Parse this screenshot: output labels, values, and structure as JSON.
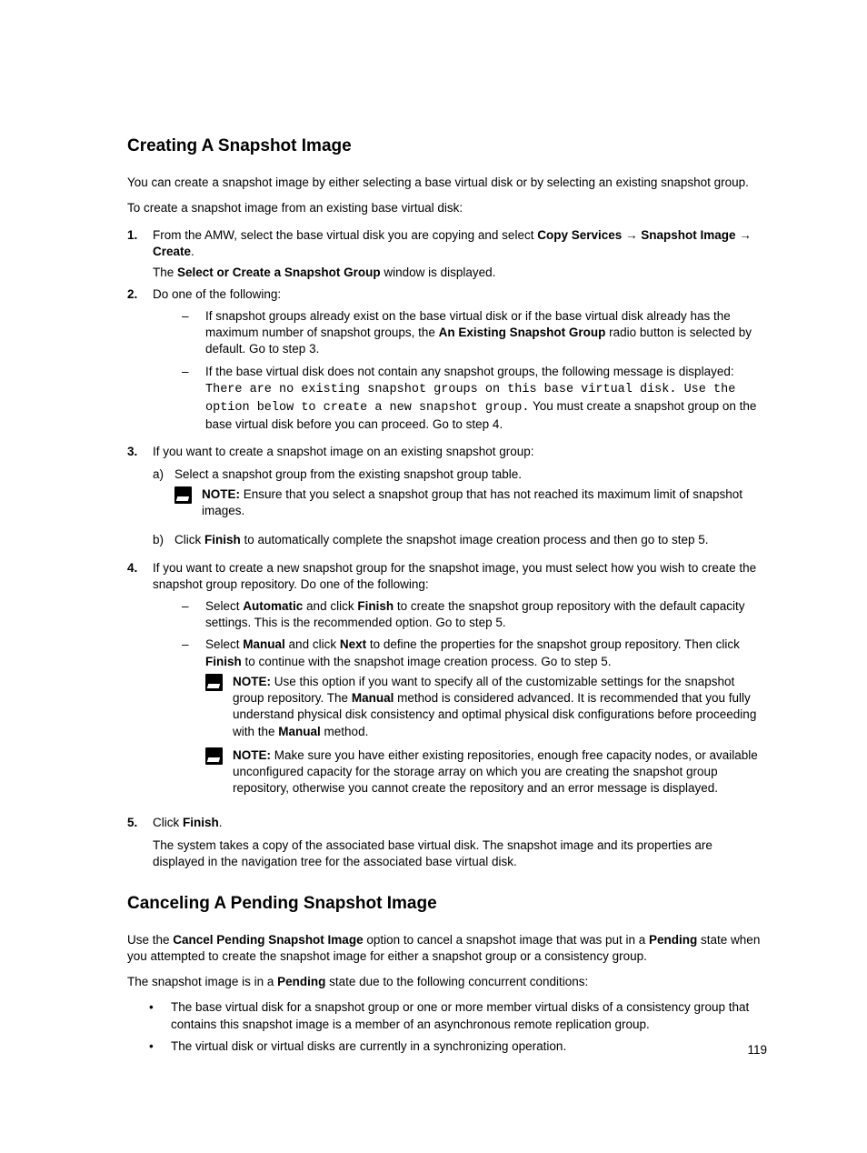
{
  "section1": {
    "heading": "Creating A Snapshot Image",
    "intro1": "You can create a snapshot image by either selecting a base virtual disk or by selecting an existing snapshot group.",
    "intro2": "To create a snapshot image from an existing base virtual disk:",
    "step1_a": "From the AMW, select the base virtual disk you are copying and select ",
    "step1_b_bold": "Copy Services → Snapshot Image → Create",
    "step1_c": ".",
    "step1_line2_a": "The ",
    "step1_line2_b": "Select or Create a Snapshot Group",
    "step1_line2_c": " window is displayed.",
    "step2": "Do one of the following:",
    "step2_d1_a": "If snapshot groups already exist on the base virtual disk or if the base virtual disk already has the maximum number of snapshot groups, the ",
    "step2_d1_b": "An Existing Snapshot Group",
    "step2_d1_c": " radio button is selected by default. Go to step 3.",
    "step2_d2_a": "If the base virtual disk does not contain any snapshot groups, the following message is displayed: ",
    "step2_d2_mono": "There are no existing snapshot groups on this base virtual disk. Use the option below to create a new snapshot group.",
    "step2_d2_b": " You must create a snapshot group on the base virtual disk before you can proceed. Go to step 4.",
    "step3": "If you want to create a snapshot image on an existing snapshot group:",
    "step3_a": "Select a snapshot group from the existing snapshot group table.",
    "note1_label": "NOTE: ",
    "note1_text": "Ensure that you select a snapshot group that has not reached its maximum limit of snapshot images.",
    "step3_b_a": "Click ",
    "step3_b_bold": "Finish",
    "step3_b_c": " to automatically complete the snapshot image creation process and then go to step 5.",
    "step4": "If you want to create a new snapshot group for the snapshot image, you must select how you wish to create the snapshot group repository. Do one of the following:",
    "step4_d1_a": "Select ",
    "step4_d1_b": "Automatic",
    "step4_d1_c": " and click ",
    "step4_d1_d": "Finish",
    "step4_d1_e": " to create the snapshot group repository with the default capacity settings. This is the recommended option. Go to step 5.",
    "step4_d2_a": "Select ",
    "step4_d2_b": "Manual",
    "step4_d2_c": " and click ",
    "step4_d2_d": "Next",
    "step4_d2_e": " to define the properties for the snapshot group repository. Then click ",
    "step4_d2_f": "Finish",
    "step4_d2_g": " to continue with the snapshot image creation process. Go to step 5.",
    "note2_label": "NOTE: ",
    "note2_a": "Use this option if you want to specify all of the customizable settings for the snapshot group repository. The ",
    "note2_b": "Manual",
    "note2_c": " method is considered advanced. It is recommended that you fully understand physical disk consistency and optimal physical disk configurations before proceeding with the ",
    "note2_d": "Manual",
    "note2_e": " method.",
    "note3_label": "NOTE: ",
    "note3_text": "Make sure you have either existing repositories, enough free capacity nodes, or available unconfigured capacity for the storage array on which you are creating the snapshot group repository, otherwise you cannot create the repository and an error message is displayed.",
    "step5_a": "Click ",
    "step5_b": "Finish",
    "step5_c": ".",
    "step5_line2": "The system takes a copy of the associated base virtual disk. The snapshot image and its properties are displayed in the navigation tree for the associated base virtual disk."
  },
  "section2": {
    "heading": "Canceling A Pending Snapshot Image",
    "p1_a": "Use the ",
    "p1_b": "Cancel Pending Snapshot Image",
    "p1_c": " option to cancel a snapshot image that was put in a ",
    "p1_d": "Pending",
    "p1_e": " state when you attempted to create the snapshot image for either a snapshot group or a consistency group.",
    "p2_a": "The snapshot image is in a ",
    "p2_b": "Pending",
    "p2_c": " state due to the following concurrent conditions:",
    "b1": "The base virtual disk for a snapshot group or one or more member virtual disks of a consistency group that contains this snapshot image is a member of an asynchronous remote replication group.",
    "b2": "The virtual disk or virtual disks are currently in a synchronizing operation."
  },
  "num1": "1.",
  "num2": "2.",
  "num3": "3.",
  "num4": "4.",
  "num5": "5.",
  "dash": "–",
  "alpha_a": "a)",
  "alpha_b": "b)",
  "bullet_dot": "•",
  "page_number": "119"
}
